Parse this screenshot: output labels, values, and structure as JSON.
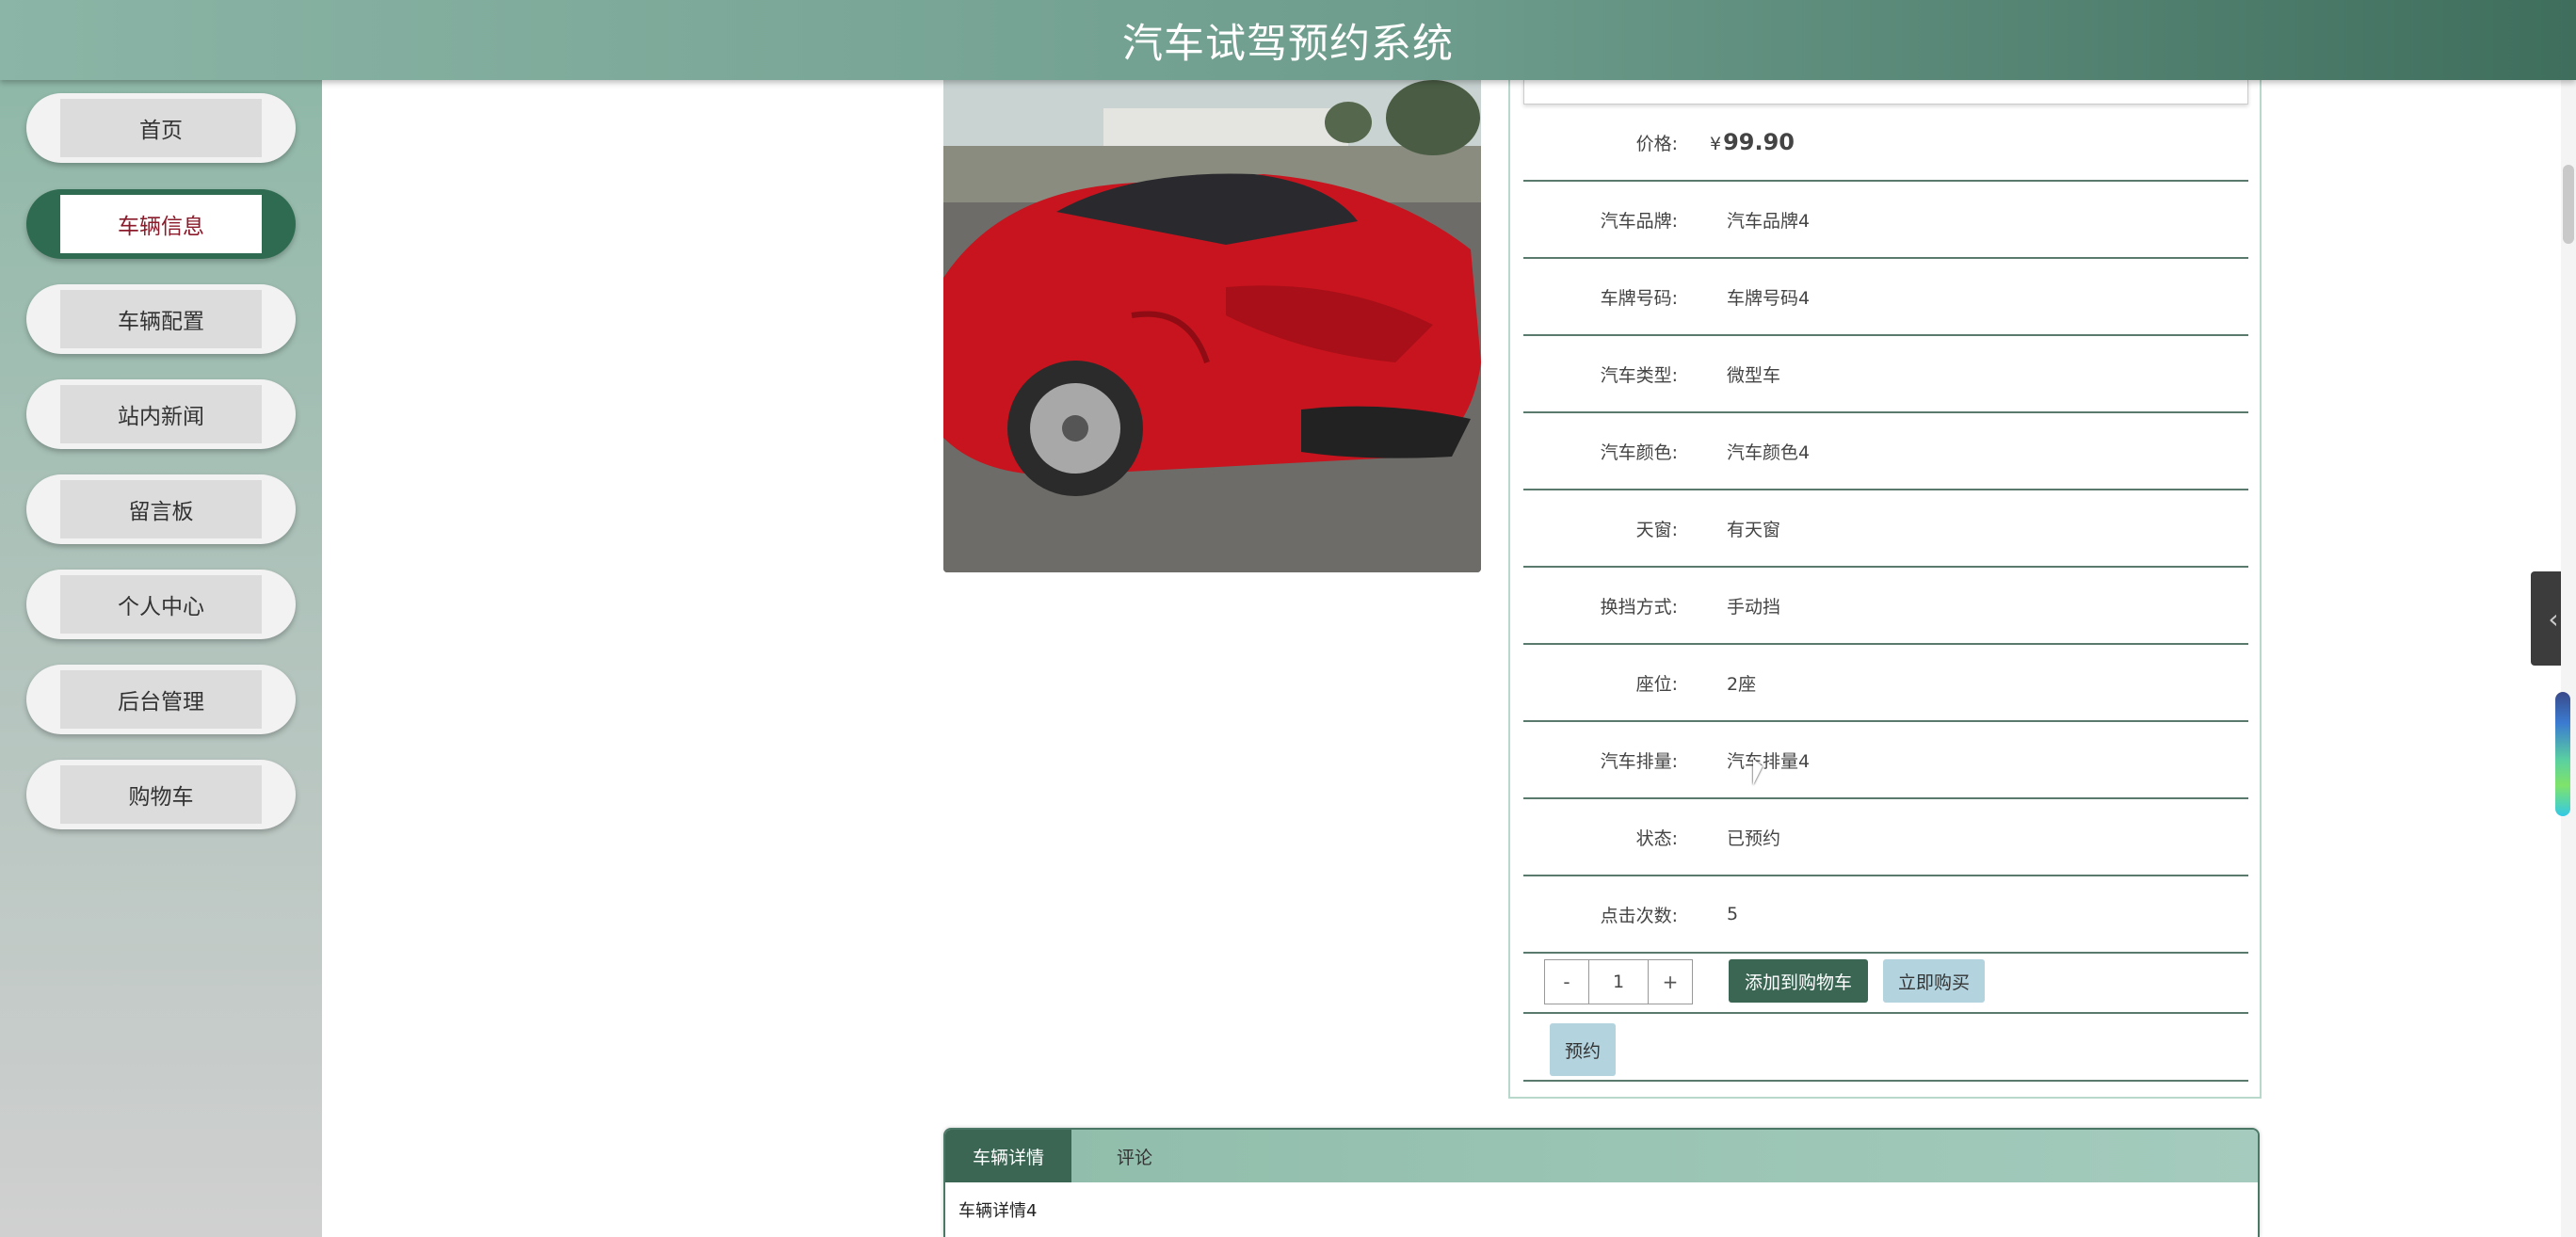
{
  "header": {
    "title": "汽车试驾预约系统"
  },
  "sidebar": {
    "items": [
      {
        "label": "首页",
        "active": false
      },
      {
        "label": "车辆信息",
        "active": true
      },
      {
        "label": "车辆配置",
        "active": false
      },
      {
        "label": "站内新闻",
        "active": false
      },
      {
        "label": "留言板",
        "active": false
      },
      {
        "label": "个人中心",
        "active": false
      },
      {
        "label": "后台管理",
        "active": false
      },
      {
        "label": "购物车",
        "active": false
      }
    ]
  },
  "details": {
    "price": {
      "label": "价格:",
      "currency": "¥",
      "value": "99.90"
    },
    "fields": [
      {
        "label": "汽车品牌:",
        "value": "汽车品牌4"
      },
      {
        "label": "车牌号码:",
        "value": "车牌号码4"
      },
      {
        "label": "汽车类型:",
        "value": "微型车"
      },
      {
        "label": "汽车颜色:",
        "value": "汽车颜色4"
      },
      {
        "label": "天窗:",
        "value": "有天窗"
      },
      {
        "label": "换挡方式:",
        "value": "手动挡"
      },
      {
        "label": "座位:",
        "value": "2座"
      },
      {
        "label": "汽车排量:",
        "value": "汽车排量4"
      },
      {
        "label": "状态:",
        "value": "已预约"
      },
      {
        "label": "点击次数:",
        "value": "5"
      }
    ]
  },
  "actions": {
    "minus": "-",
    "quantity": "1",
    "plus": "+",
    "add_to_cart": "添加到购物车",
    "buy_now": "立即购买",
    "book": "预约"
  },
  "tabs": {
    "items": [
      {
        "label": "车辆详情",
        "active": true
      },
      {
        "label": "评论",
        "active": false
      }
    ],
    "content": "车辆详情4"
  },
  "colors": {
    "brand_green": "#3b6654",
    "header_gradient_start": "#8bb5a6",
    "header_gradient_end": "#3f6e5d",
    "accent_light_blue": "#b3d3de",
    "active_nav_text": "#8b1a2a"
  },
  "icons": {
    "side_toggle": "chevron-left-icon"
  }
}
